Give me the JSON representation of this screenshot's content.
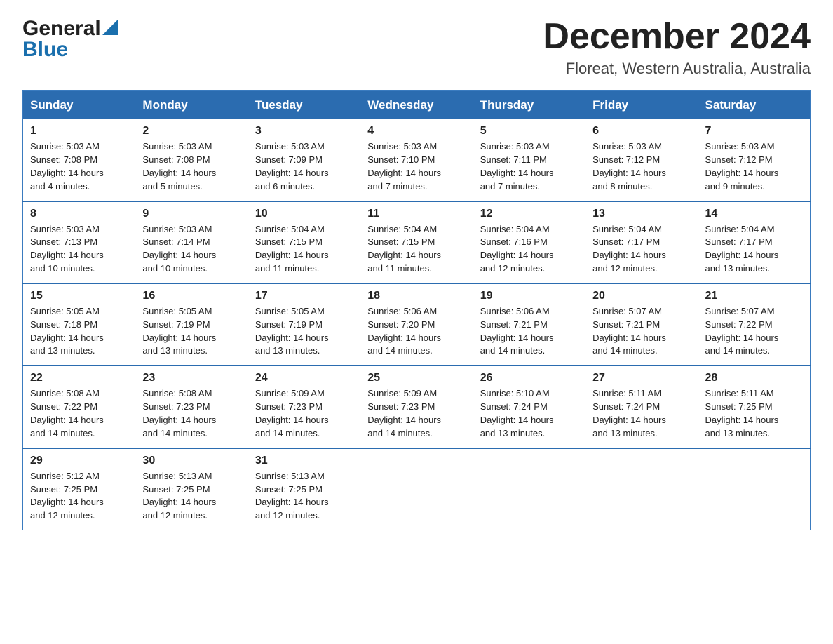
{
  "logo": {
    "general": "General",
    "blue": "Blue"
  },
  "title": {
    "month": "December 2024",
    "location": "Floreat, Western Australia, Australia"
  },
  "days_of_week": [
    "Sunday",
    "Monday",
    "Tuesday",
    "Wednesday",
    "Thursday",
    "Friday",
    "Saturday"
  ],
  "weeks": [
    [
      {
        "day": "1",
        "sunrise": "5:03 AM",
        "sunset": "7:08 PM",
        "daylight": "14 hours and 4 minutes."
      },
      {
        "day": "2",
        "sunrise": "5:03 AM",
        "sunset": "7:08 PM",
        "daylight": "14 hours and 5 minutes."
      },
      {
        "day": "3",
        "sunrise": "5:03 AM",
        "sunset": "7:09 PM",
        "daylight": "14 hours and 6 minutes."
      },
      {
        "day": "4",
        "sunrise": "5:03 AM",
        "sunset": "7:10 PM",
        "daylight": "14 hours and 7 minutes."
      },
      {
        "day": "5",
        "sunrise": "5:03 AM",
        "sunset": "7:11 PM",
        "daylight": "14 hours and 7 minutes."
      },
      {
        "day": "6",
        "sunrise": "5:03 AM",
        "sunset": "7:12 PM",
        "daylight": "14 hours and 8 minutes."
      },
      {
        "day": "7",
        "sunrise": "5:03 AM",
        "sunset": "7:12 PM",
        "daylight": "14 hours and 9 minutes."
      }
    ],
    [
      {
        "day": "8",
        "sunrise": "5:03 AM",
        "sunset": "7:13 PM",
        "daylight": "14 hours and 10 minutes."
      },
      {
        "day": "9",
        "sunrise": "5:03 AM",
        "sunset": "7:14 PM",
        "daylight": "14 hours and 10 minutes."
      },
      {
        "day": "10",
        "sunrise": "5:04 AM",
        "sunset": "7:15 PM",
        "daylight": "14 hours and 11 minutes."
      },
      {
        "day": "11",
        "sunrise": "5:04 AM",
        "sunset": "7:15 PM",
        "daylight": "14 hours and 11 minutes."
      },
      {
        "day": "12",
        "sunrise": "5:04 AM",
        "sunset": "7:16 PM",
        "daylight": "14 hours and 12 minutes."
      },
      {
        "day": "13",
        "sunrise": "5:04 AM",
        "sunset": "7:17 PM",
        "daylight": "14 hours and 12 minutes."
      },
      {
        "day": "14",
        "sunrise": "5:04 AM",
        "sunset": "7:17 PM",
        "daylight": "14 hours and 13 minutes."
      }
    ],
    [
      {
        "day": "15",
        "sunrise": "5:05 AM",
        "sunset": "7:18 PM",
        "daylight": "14 hours and 13 minutes."
      },
      {
        "day": "16",
        "sunrise": "5:05 AM",
        "sunset": "7:19 PM",
        "daylight": "14 hours and 13 minutes."
      },
      {
        "day": "17",
        "sunrise": "5:05 AM",
        "sunset": "7:19 PM",
        "daylight": "14 hours and 13 minutes."
      },
      {
        "day": "18",
        "sunrise": "5:06 AM",
        "sunset": "7:20 PM",
        "daylight": "14 hours and 14 minutes."
      },
      {
        "day": "19",
        "sunrise": "5:06 AM",
        "sunset": "7:21 PM",
        "daylight": "14 hours and 14 minutes."
      },
      {
        "day": "20",
        "sunrise": "5:07 AM",
        "sunset": "7:21 PM",
        "daylight": "14 hours and 14 minutes."
      },
      {
        "day": "21",
        "sunrise": "5:07 AM",
        "sunset": "7:22 PM",
        "daylight": "14 hours and 14 minutes."
      }
    ],
    [
      {
        "day": "22",
        "sunrise": "5:08 AM",
        "sunset": "7:22 PM",
        "daylight": "14 hours and 14 minutes."
      },
      {
        "day": "23",
        "sunrise": "5:08 AM",
        "sunset": "7:23 PM",
        "daylight": "14 hours and 14 minutes."
      },
      {
        "day": "24",
        "sunrise": "5:09 AM",
        "sunset": "7:23 PM",
        "daylight": "14 hours and 14 minutes."
      },
      {
        "day": "25",
        "sunrise": "5:09 AM",
        "sunset": "7:23 PM",
        "daylight": "14 hours and 14 minutes."
      },
      {
        "day": "26",
        "sunrise": "5:10 AM",
        "sunset": "7:24 PM",
        "daylight": "14 hours and 13 minutes."
      },
      {
        "day": "27",
        "sunrise": "5:11 AM",
        "sunset": "7:24 PM",
        "daylight": "14 hours and 13 minutes."
      },
      {
        "day": "28",
        "sunrise": "5:11 AM",
        "sunset": "7:25 PM",
        "daylight": "14 hours and 13 minutes."
      }
    ],
    [
      {
        "day": "29",
        "sunrise": "5:12 AM",
        "sunset": "7:25 PM",
        "daylight": "14 hours and 12 minutes."
      },
      {
        "day": "30",
        "sunrise": "5:13 AM",
        "sunset": "7:25 PM",
        "daylight": "14 hours and 12 minutes."
      },
      {
        "day": "31",
        "sunrise": "5:13 AM",
        "sunset": "7:25 PM",
        "daylight": "14 hours and 12 minutes."
      },
      null,
      null,
      null,
      null
    ]
  ],
  "labels": {
    "sunrise": "Sunrise:",
    "sunset": "Sunset:",
    "daylight": "Daylight:"
  }
}
